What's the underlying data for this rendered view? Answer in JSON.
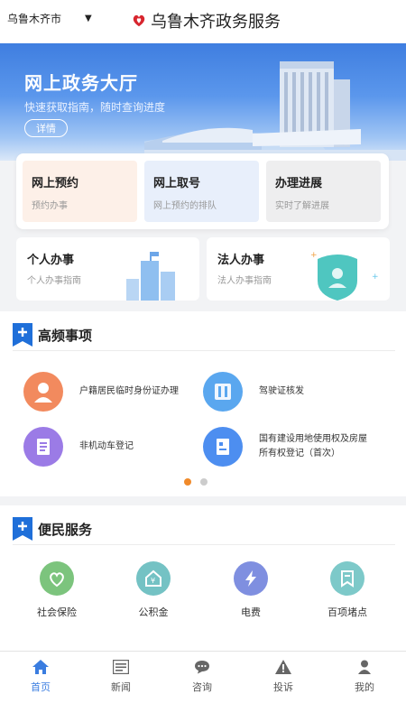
{
  "header": {
    "city": "乌鲁木齐市",
    "title": "乌鲁木齐政务服务"
  },
  "banner": {
    "title": "网上政务大厅",
    "subtitle": "快速获取指南，随时查询进度",
    "detail_label": "详情"
  },
  "quick_cards": [
    {
      "title": "网上预约",
      "subtitle": "预约办事"
    },
    {
      "title": "网上取号",
      "subtitle": "网上预约的排队"
    },
    {
      "title": "办理进展",
      "subtitle": "实时了解进展"
    }
  ],
  "service_cards": [
    {
      "title": "个人办事",
      "subtitle": "个人办事指南"
    },
    {
      "title": "法人办事",
      "subtitle": "法人办事指南"
    }
  ],
  "high_freq": {
    "title": "高频事项",
    "items": [
      {
        "label": "户籍居民临时身份证办理",
        "icon": "person-icon",
        "color": "#f28a5e"
      },
      {
        "label": "驾驶证核发",
        "icon": "id-card-icon",
        "color": "#5aa7ef"
      },
      {
        "label": "非机动车登记",
        "icon": "document-icon",
        "color": "#9b7be6"
      },
      {
        "label": "国有建设用地使用权及房屋所有权登记（首次）",
        "icon": "certificate-icon",
        "color": "#4d8ef0"
      }
    ],
    "page_active": 1,
    "page_count": 2
  },
  "convenience": {
    "title": "便民服务",
    "items": [
      {
        "label": "社会保险",
        "icon": "insurance-icon",
        "color": "#7cc47d"
      },
      {
        "label": "公积金",
        "icon": "fund-icon",
        "color": "#74c2c4"
      },
      {
        "label": "电费",
        "icon": "electricity-icon",
        "color": "#7f8fe0"
      },
      {
        "label": "百项堵点",
        "icon": "bookmark-icon",
        "color": "#7dc9c9"
      }
    ]
  },
  "tabbar": {
    "items": [
      {
        "label": "首页",
        "icon": "home-icon"
      },
      {
        "label": "新闻",
        "icon": "news-icon"
      },
      {
        "label": "咨询",
        "icon": "chat-icon"
      },
      {
        "label": "投诉",
        "icon": "warning-icon"
      },
      {
        "label": "我的",
        "icon": "user-icon"
      }
    ],
    "active": "首页",
    "active_color": "#3a7de0"
  },
  "colors": {
    "accent": "#3a7de0",
    "dot_active": "#f08a2a",
    "dot_inactive": "#cccccc"
  }
}
